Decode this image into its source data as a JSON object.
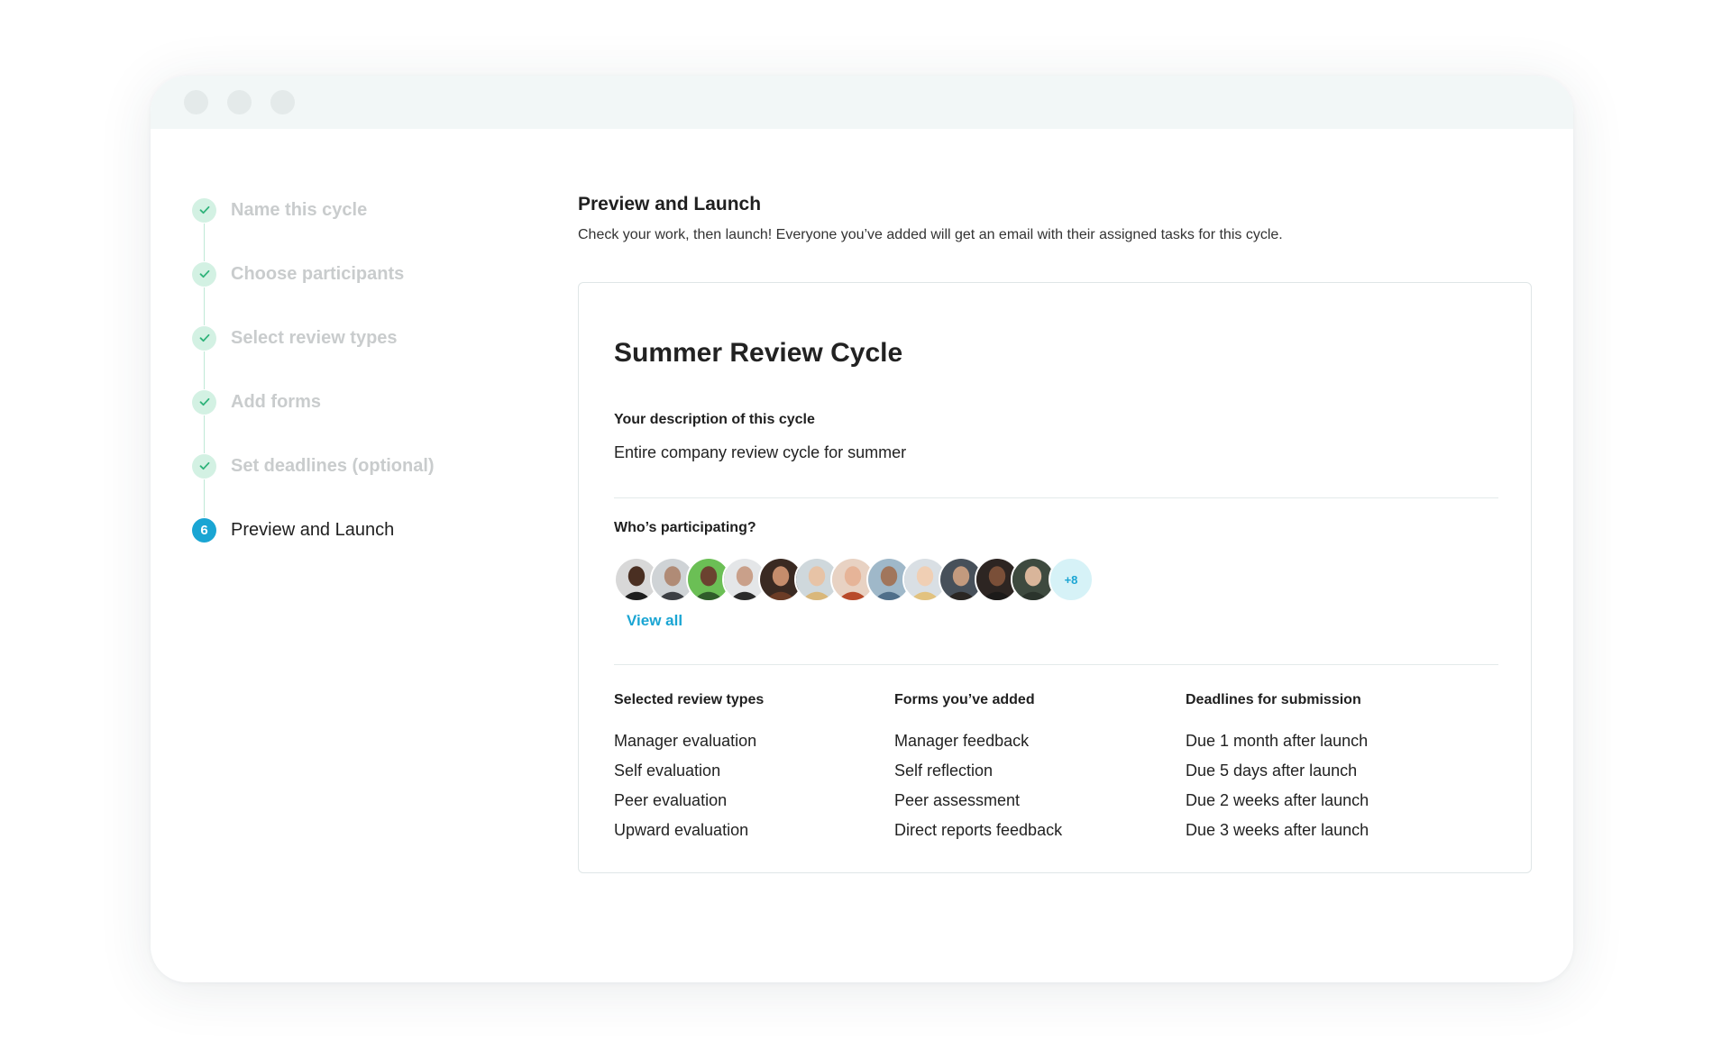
{
  "steps": [
    {
      "label": "Name this cycle"
    },
    {
      "label": "Choose participants"
    },
    {
      "label": "Select review types"
    },
    {
      "label": "Add forms"
    },
    {
      "label": "Set deadlines (optional)"
    },
    {
      "label": "Preview and Launch",
      "number": "6"
    }
  ],
  "main": {
    "title": "Preview and Launch",
    "subtitle": "Check your work, then launch! Everyone you’ve added will get an email with their assigned tasks for this cycle."
  },
  "card": {
    "cycle_name": "Summer Review Cycle",
    "description_label": "Your description of this cycle",
    "description_value": "Entire company review cycle for summer",
    "participants_label": "Who’s participating?",
    "more_count": "+8",
    "view_all": "View all",
    "review_types_head": "Selected review types",
    "review_types": [
      "Manager evaluation",
      "Self evaluation",
      "Peer evaluation",
      "Upward evaluation"
    ],
    "forms_head": "Forms you’ve added",
    "forms": [
      "Manager feedback",
      "Self reflection",
      "Peer assessment",
      "Direct reports feedback"
    ],
    "deadlines_head": "Deadlines for submission",
    "deadlines": [
      "Due 1 month after launch",
      "Due 5 days after launch",
      "Due 2 weeks after launch",
      "Due 3 weeks after launch"
    ]
  },
  "colors": {
    "accent": "#1aa5d3",
    "step_done_bg": "#d3f1e3",
    "step_check": "#2fb37a"
  }
}
